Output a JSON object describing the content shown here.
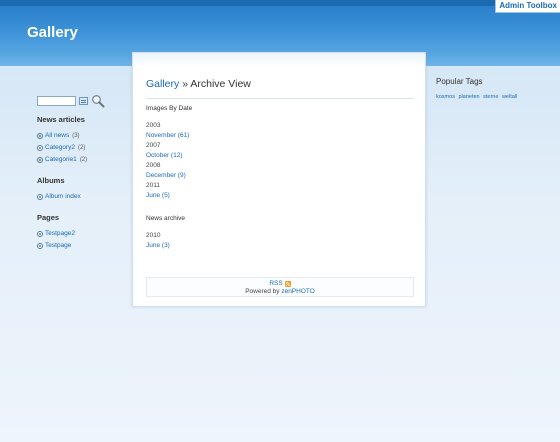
{
  "site": {
    "title": "Gallery"
  },
  "admin_toolbox": {
    "label": "Admin Toolbox"
  },
  "search": {
    "value": "",
    "placeholder": ""
  },
  "sidebar": {
    "news": {
      "heading": "News articles",
      "items": [
        {
          "label": "All news",
          "count": "(3)"
        },
        {
          "label": "Category2",
          "count": "(2)"
        },
        {
          "label": "Categorie1",
          "count": "(2)"
        }
      ]
    },
    "albums": {
      "heading": "Albums",
      "items": [
        {
          "label": "Album index"
        }
      ]
    },
    "pages": {
      "heading": "Pages",
      "items": [
        {
          "label": "Testpage2"
        },
        {
          "label": "Testpage"
        }
      ]
    }
  },
  "main": {
    "breadcrumb_link": "Gallery",
    "separator": "»",
    "page_title": "Archive View",
    "images_by_date": {
      "title": "Images By Date",
      "groups": [
        {
          "year": "2003",
          "month": "November (61)"
        },
        {
          "year": "2007",
          "month": "October (12)"
        },
        {
          "year": "2008",
          "month": "December (9)"
        },
        {
          "year": "2011",
          "month": "June (5)"
        }
      ]
    },
    "news_archive": {
      "title": "News archive",
      "groups": [
        {
          "year": "2010",
          "month": "June (3)"
        }
      ]
    },
    "footer": {
      "rss": "RSS",
      "powered_by": "Powered by",
      "zenphoto": "zenPHOTO"
    }
  },
  "tags": {
    "title": "Popular Tags",
    "items": [
      "kosmos",
      "planeten",
      "sterne",
      "weltall"
    ]
  },
  "colors": {
    "header_blue": "#2a80cc",
    "link_blue": "#1a6bb5",
    "rss_orange": "#f39a1d"
  }
}
